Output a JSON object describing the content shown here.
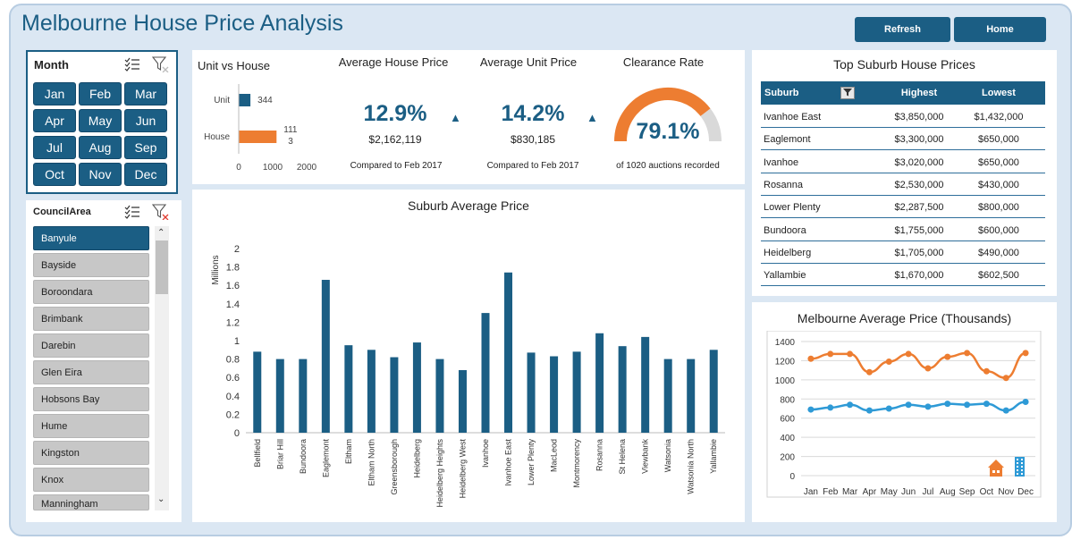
{
  "header": {
    "title": "Melbourne House Price Analysis",
    "refresh_label": "Refresh",
    "home_label": "Home"
  },
  "month_slicer": {
    "title": "Month",
    "months": [
      "Jan",
      "Feb",
      "Mar",
      "Apr",
      "May",
      "Jun",
      "Jul",
      "Aug",
      "Sep",
      "Oct",
      "Nov",
      "Dec"
    ]
  },
  "council_slicer": {
    "title": "CouncilArea",
    "items": [
      "Banyule",
      "Bayside",
      "Boroondara",
      "Brimbank",
      "Darebin",
      "Glen Eira",
      "Hobsons Bay",
      "Hume",
      "Kingston",
      "Knox",
      "Manningham"
    ],
    "selected": "Banyule"
  },
  "unit_vs_house": {
    "title": "Unit vs House",
    "categories": [
      "Unit",
      "House"
    ],
    "values": [
      344,
      1113
    ],
    "value_labels": [
      "344",
      "111\n3"
    ],
    "axis_ticks": [
      "0",
      "1000",
      "2000"
    ],
    "colors": [
      "#1b5e84",
      "#ed7d31"
    ]
  },
  "kpis": {
    "house": {
      "title": "Average House Price",
      "pct": "12.9%",
      "value": "$2,162,119",
      "sub": "Compared to Feb 2017",
      "arrow": "▲"
    },
    "unit": {
      "title": "Average Unit Price",
      "pct": "14.2%",
      "value": "$830,185",
      "sub": "Compared to Feb 2017",
      "arrow": "▲"
    },
    "clearance": {
      "title": "Clearance Rate",
      "pct": "79.1%",
      "fraction": 0.791,
      "sub": "of 1020 auctions recorded"
    }
  },
  "suburb_chart": {
    "title": "Suburb Average Price",
    "ylabel": "Millions",
    "chart_data": {
      "type": "bar",
      "categories": [
        "Bellfield",
        "Briar Hill",
        "Bundoora",
        "Eaglemont",
        "Eltham",
        "Eltham North",
        "Greensborough",
        "Heidelberg",
        "Heidelberg Heights",
        "Heidelberg West",
        "Ivanhoe",
        "Ivanhoe East",
        "Lower Plenty",
        "MacLeod",
        "Montmorency",
        "Rosanna",
        "St Helena",
        "Viewbank",
        "Watsonia",
        "Watsonia North",
        "Yallambie"
      ],
      "values": [
        0.88,
        0.8,
        0.8,
        1.66,
        0.95,
        0.9,
        0.82,
        0.98,
        0.8,
        0.68,
        1.3,
        1.74,
        0.87,
        0.83,
        0.88,
        1.08,
        0.94,
        1.04,
        0.8,
        0.8,
        0.9
      ],
      "yticks": [
        "0",
        "0.2",
        "0.4",
        "0.6",
        "0.8",
        "1",
        "1.2",
        "1.4",
        "1.6",
        "1.8",
        "2"
      ],
      "ylim": [
        0,
        2
      ],
      "color": "#1b5e84"
    }
  },
  "top_suburbs": {
    "title": "Top Suburb House Prices",
    "headers": [
      "Suburb",
      "Highest",
      "Lowest"
    ],
    "rows": [
      [
        "Ivanhoe East",
        "$3,850,000",
        "$1,432,000"
      ],
      [
        "Eaglemont",
        "$3,300,000",
        "$650,000"
      ],
      [
        "Ivanhoe",
        "$3,020,000",
        "$650,000"
      ],
      [
        "Rosanna",
        "$2,530,000",
        "$430,000"
      ],
      [
        "Lower Plenty",
        "$2,287,500",
        "$800,000"
      ],
      [
        "Bundoora",
        "$1,755,000",
        "$600,000"
      ],
      [
        "Heidelberg",
        "$1,705,000",
        "$490,000"
      ],
      [
        "Yallambie",
        "$1,670,000",
        "$602,500"
      ]
    ]
  },
  "avg_price_chart": {
    "title": "Melbourne Average Price (Thousands)",
    "chart_data": {
      "type": "line",
      "categories": [
        "Jan",
        "Feb",
        "Mar",
        "Apr",
        "May",
        "Jun",
        "Jul",
        "Aug",
        "Sep",
        "Oct",
        "Nov",
        "Dec"
      ],
      "series": [
        {
          "values": [
            1220,
            1270,
            1270,
            1080,
            1190,
            1270,
            1120,
            1240,
            1280,
            1090,
            1020,
            1280
          ],
          "color": "#ed7d31"
        },
        {
          "values": [
            690,
            710,
            740,
            680,
            700,
            740,
            720,
            750,
            740,
            750,
            680,
            770
          ],
          "color": "#2e9ad6"
        }
      ],
      "yticks": [
        "0",
        "200",
        "400",
        "600",
        "800",
        "1000",
        "1200",
        "1400"
      ],
      "ylim": [
        0,
        1400
      ],
      "grid": true
    }
  }
}
